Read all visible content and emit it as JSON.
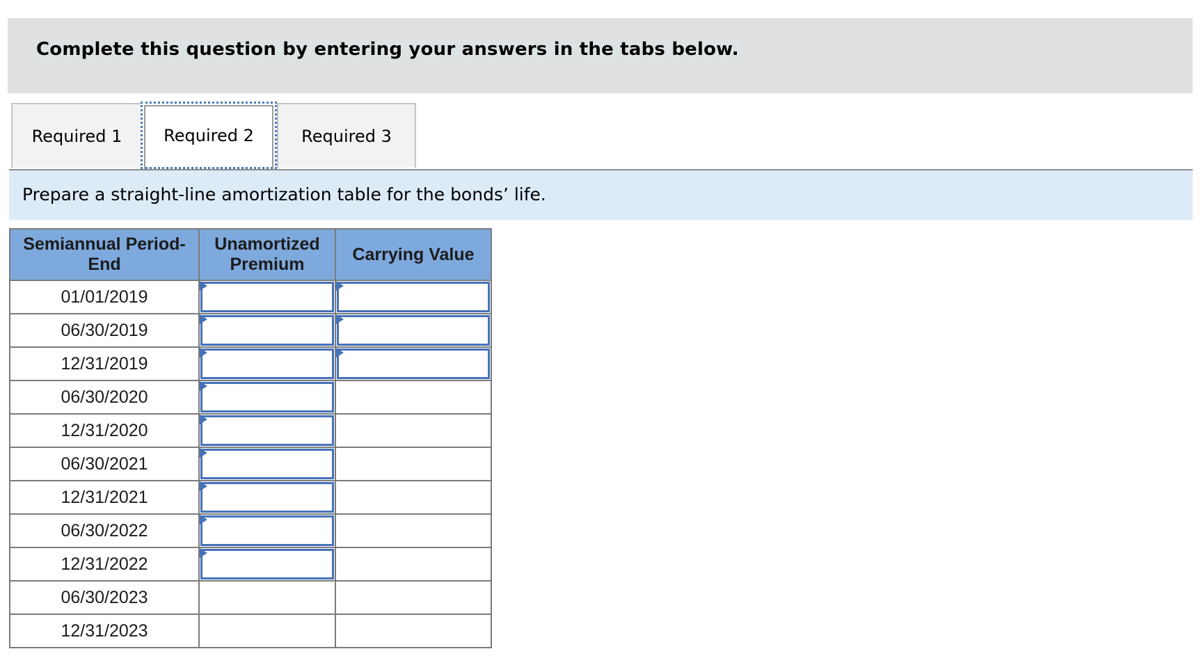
{
  "banner": {
    "text": "Complete this question by entering your answers in the tabs below."
  },
  "tabs": [
    {
      "label": "Required 1",
      "active": false
    },
    {
      "label": "Required 2",
      "active": true
    },
    {
      "label": "Required 3",
      "active": false
    }
  ],
  "instruction": "Prepare a straight-line amortization table for the bonds’ life.",
  "table": {
    "headers": [
      "Semiannual Period-End",
      "Unamortized Premium",
      "Carrying Value"
    ],
    "header_lines": [
      [
        "Semiannual Period-",
        "End"
      ],
      [
        "Unamortized",
        "Premium"
      ],
      [
        "Carrying Value"
      ]
    ],
    "rows": [
      {
        "date": "01/01/2019",
        "premium": "",
        "carrying": ""
      },
      {
        "date": "06/30/2019",
        "premium": "",
        "carrying": ""
      },
      {
        "date": "12/31/2019",
        "premium": "",
        "carrying": ""
      },
      {
        "date": "06/30/2020",
        "premium": ""
      },
      {
        "date": "12/31/2020",
        "premium": ""
      },
      {
        "date": "06/30/2021",
        "premium": ""
      },
      {
        "date": "12/31/2021",
        "premium": ""
      },
      {
        "date": "06/30/2022",
        "premium": ""
      },
      {
        "date": "12/31/2022",
        "premium": ""
      },
      {
        "date": "06/30/2023"
      },
      {
        "date": "12/31/2023"
      }
    ]
  },
  "colors": {
    "header_bg": "#7ea9dd",
    "input_border": "#4572b7",
    "instruction_bg": "#ddebf7",
    "banner_bg": "#e0e0e0"
  }
}
